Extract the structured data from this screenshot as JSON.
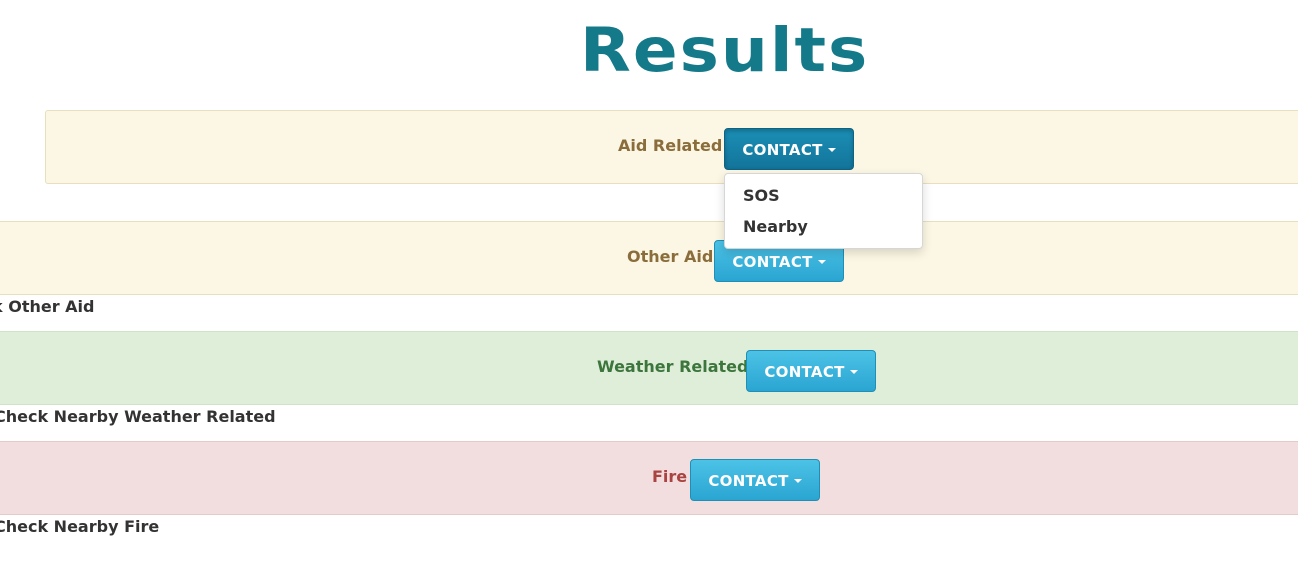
{
  "page": {
    "title": "Results"
  },
  "sections": {
    "aid_related": {
      "label": "Aid Related",
      "button": "CONTACT",
      "dropdown": [
        "SOS",
        "Nearby"
      ],
      "color": "#fcf7e4"
    },
    "other_aid": {
      "label": "Other Aid",
      "button": "CONTACT",
      "sub_text": "k Other Aid",
      "color": "#fcf7e4"
    },
    "weather_related": {
      "label": "Weather Related",
      "button": "CONTACT",
      "sub_text": "Check Nearby Weather Related",
      "color": "#dfeed8"
    },
    "fire": {
      "label": "Fire",
      "button": "CONTACT",
      "sub_text": "Check Nearby Fire",
      "color": "#f2dede"
    }
  },
  "icons": {
    "button_caret": "caret-down-icon"
  },
  "colors": {
    "title": "#147a8a",
    "button": "#2aa5d2",
    "button_active": "#13749a"
  }
}
